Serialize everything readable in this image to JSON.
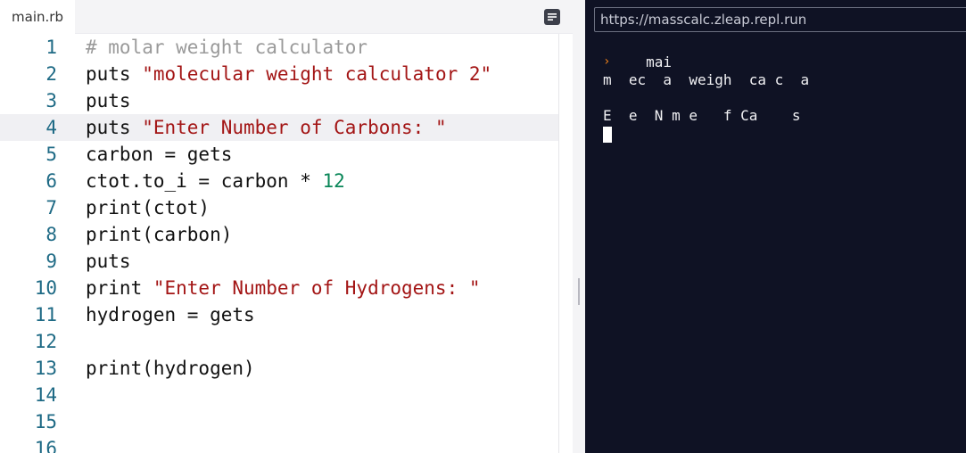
{
  "editor": {
    "tab_label": "main.rb",
    "menu_icon": "hamburger-menu-icon",
    "active_line": 4,
    "lines": [
      {
        "n": "1",
        "segments": [
          {
            "t": "# molar weight calculator",
            "k": "cmt"
          }
        ]
      },
      {
        "n": "2",
        "segments": [
          {
            "t": "puts ",
            "k": "txt"
          },
          {
            "t": "\"molecular weight calculator 2\"",
            "k": "str"
          }
        ]
      },
      {
        "n": "3",
        "segments": [
          {
            "t": "puts",
            "k": "txt"
          }
        ]
      },
      {
        "n": "4",
        "segments": [
          {
            "t": "puts ",
            "k": "txt"
          },
          {
            "t": "\"Enter Number of Carbons: \"",
            "k": "str"
          }
        ]
      },
      {
        "n": "5",
        "segments": [
          {
            "t": "carbon = gets",
            "k": "txt"
          }
        ]
      },
      {
        "n": "6",
        "segments": [
          {
            "t": "ctot.to_i = carbon * ",
            "k": "txt"
          },
          {
            "t": "12",
            "k": "num"
          }
        ]
      },
      {
        "n": "7",
        "segments": [
          {
            "t": "print(ctot)",
            "k": "txt"
          }
        ]
      },
      {
        "n": "8",
        "segments": [
          {
            "t": "print(carbon)",
            "k": "txt"
          }
        ]
      },
      {
        "n": "9",
        "segments": [
          {
            "t": "puts",
            "k": "txt"
          }
        ]
      },
      {
        "n": "10",
        "segments": [
          {
            "t": "print ",
            "k": "txt"
          },
          {
            "t": "\"Enter Number of Hydrogens: \"",
            "k": "str"
          }
        ]
      },
      {
        "n": "11",
        "segments": [
          {
            "t": "hydrogen = gets",
            "k": "txt"
          }
        ]
      },
      {
        "n": "12",
        "segments": []
      },
      {
        "n": "13",
        "segments": [
          {
            "t": "print(hydrogen)",
            "k": "txt"
          }
        ]
      },
      {
        "n": "14",
        "segments": []
      },
      {
        "n": "15",
        "segments": []
      },
      {
        "n": "16",
        "segments": []
      }
    ]
  },
  "console": {
    "url": "https://masscalc.zleap.repl.run",
    "prompt_glyph": "›",
    "output_lines": [
      "     mai",
      "m  ec  a  weigh  ca c  a",
      "",
      "E  e  N m e   f Ca    s"
    ]
  },
  "colors": {
    "console_bg": "#0f1224",
    "prompt_accent": "#f08019",
    "string": "#a31515",
    "number": "#098658",
    "comment": "#9a9a9a",
    "line_number": "#1e6a85"
  }
}
